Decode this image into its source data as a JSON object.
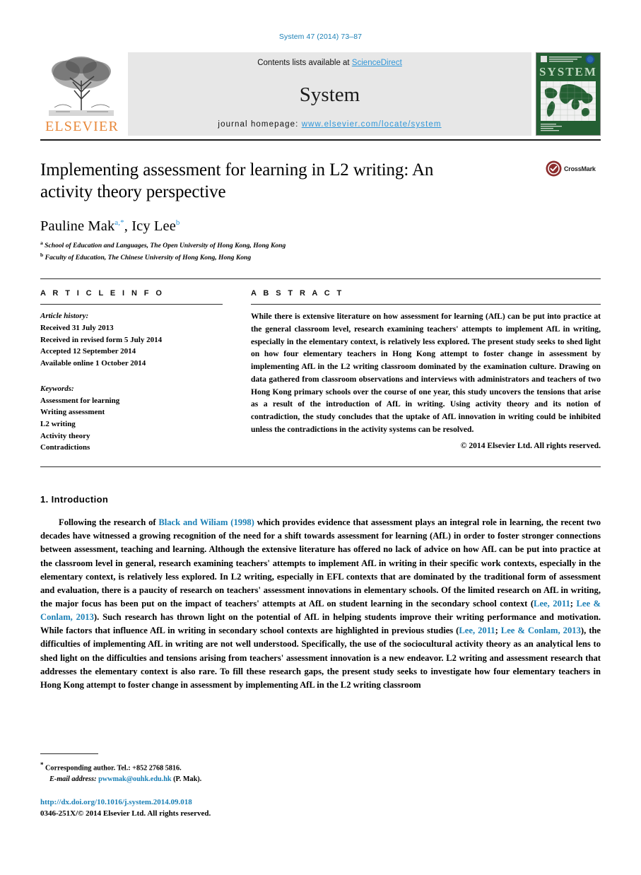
{
  "running_head": "System 47 (2014) 73–87",
  "header": {
    "publisher": "ELSEVIER",
    "contents_prefix": "Contents lists available at ",
    "contents_link": "ScienceDirect",
    "journal_name": "System",
    "homepage_label": "journal homepage: ",
    "homepage_url": "www.elsevier.com/locate/system",
    "cover": {
      "title": "SYSTEM",
      "subtitle": "AN INTERNATIONAL JOURNAL OF EDUCATIONAL TECHNOLOGY AND APPLIED LINGUISTICS"
    }
  },
  "article": {
    "title": "Implementing assessment for learning in L2 writing: An activity theory perspective",
    "authors": [
      {
        "name": "Pauline Mak",
        "marks": "a,*"
      },
      {
        "name": "Icy Lee",
        "marks": "b"
      }
    ],
    "authors_line": "Pauline Mak",
    "author_two": "Icy Lee",
    "affiliations": [
      {
        "mark": "a",
        "text": "School of Education and Languages, The Open University of Hong Kong, Hong Kong"
      },
      {
        "mark": "b",
        "text": "Faculty of Education, The Chinese University of Hong Kong, Hong Kong"
      }
    ],
    "crossmark_label": "CrossMark"
  },
  "article_info": {
    "heading": "A R T I C L E  I N F O",
    "history_label": "Article history:",
    "history": [
      "Received 31 July 2013",
      "Received in revised form 5 July 2014",
      "Accepted 12 September 2014",
      "Available online 1 October 2014"
    ],
    "keywords_label": "Keywords:",
    "keywords": [
      "Assessment for learning",
      "Writing assessment",
      "L2 writing",
      "Activity theory",
      "Contradictions"
    ]
  },
  "abstract": {
    "heading": "A B S T R A C T",
    "text": "While there is extensive literature on how assessment for learning (AfL) can be put into practice at the general classroom level, research examining teachers' attempts to implement AfL in writing, especially in the elementary context, is relatively less explored. The present study seeks to shed light on how four elementary teachers in Hong Kong attempt to foster change in assessment by implementing AfL in the L2 writing classroom dominated by the examination culture. Drawing on data gathered from classroom observations and interviews with administrators and teachers of two Hong Kong primary schools over the course of one year, this study uncovers the tensions that arise as a result of the introduction of AfL in writing. Using activity theory and its notion of contradiction, the study concludes that the uptake of AfL innovation in writing could be inhibited unless the contradictions in the activity systems can be resolved.",
    "copyright": "© 2014 Elsevier Ltd. All rights reserved."
  },
  "body": {
    "section_heading": "1. Introduction",
    "paragraph_parts": [
      {
        "type": "text",
        "value": "Following the research of "
      },
      {
        "type": "cite",
        "value": "Black and Wiliam (1998)"
      },
      {
        "type": "text",
        "value": " which provides evidence that assessment plays an integral role in learning, the recent two decades have witnessed a growing recognition of the need for a shift towards assessment for learning (AfL) in order to foster stronger connections between assessment, teaching and learning. Although the extensive literature has offered no lack of advice on how AfL can be put into practice at the classroom level in general, research examining teachers' attempts to implement AfL in writing in their specific work contexts, especially in the elementary context, is relatively less explored. In L2 writing, especially in EFL contexts that are dominated by the traditional form of assessment and evaluation, there is a paucity of research on teachers' assessment innovations in elementary schools. Of the limited research on AfL in writing, the major focus has been put on the impact of teachers' attempts at AfL on student learning in the secondary school context ("
      },
      {
        "type": "cite",
        "value": "Lee, 2011"
      },
      {
        "type": "text",
        "value": "; "
      },
      {
        "type": "cite",
        "value": "Lee & Conlam, 2013"
      },
      {
        "type": "text",
        "value": "). Such research has thrown light on the potential of AfL in helping students improve their writing performance and motivation. While factors that influence AfL in writing in secondary school contexts are highlighted in previous studies ("
      },
      {
        "type": "cite",
        "value": "Lee, 2011"
      },
      {
        "type": "text",
        "value": "; "
      },
      {
        "type": "cite",
        "value": "Lee & Conlam, 2013"
      },
      {
        "type": "text",
        "value": "), the difficulties of implementing AfL in writing are not well understood. Specifically, the use of the sociocultural activity theory as an analytical lens to shed light on the difficulties and tensions arising from teachers' assessment innovation is a new endeavor. L2 writing and assessment research that addresses the elementary context is also rare. To fill these research gaps, the present study seeks to investigate how four elementary teachers in Hong Kong attempt to foster change in assessment by implementing AfL in the L2 writing classroom"
      }
    ]
  },
  "footnote": {
    "star": "*",
    "corresponding": "Corresponding author. Tel.: +852 2768 5816.",
    "email_label": "E-mail address:",
    "email": "pwwmak@ouhk.edu.hk",
    "email_suffix": "(P. Mak)."
  },
  "bottom": {
    "doi": "http://dx.doi.org/10.1016/j.system.2014.09.018",
    "issn_copyright": "0346-251X/© 2014 Elsevier Ltd. All rights reserved."
  },
  "colors": {
    "link": "#1a7fb5",
    "science_direct": "#2f96d8",
    "elsevier_orange": "#e8883a",
    "cover_green": "#245f33",
    "crossmark_red": "#8c2d2d"
  }
}
